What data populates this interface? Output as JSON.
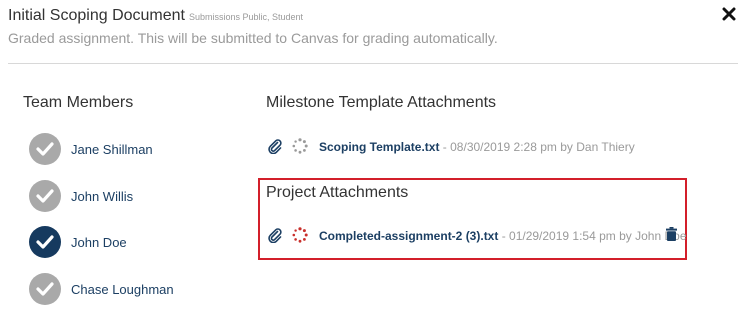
{
  "assignment": {
    "title": "Initial Scoping Document",
    "meta": "Submissions Public, Student",
    "description": "Graded assignment. This will be submitted to Canvas for grading automatically."
  },
  "team": {
    "heading": "Team Members",
    "members": [
      {
        "name": "Jane Shillman",
        "status": "inactive"
      },
      {
        "name": "John Willis",
        "status": "inactive"
      },
      {
        "name": "John Doe",
        "status": "active"
      },
      {
        "name": "Chase Loughman",
        "status": "inactive"
      }
    ]
  },
  "milestone": {
    "heading": "Milestone Template Attachments",
    "file": "Scoping Template.txt",
    "info": " - 08/30/2019 2:28 pm by Dan Thiery"
  },
  "project": {
    "heading": "Project Attachments",
    "file": "Completed-assignment-2 (3).txt",
    "info": " - 01/29/2019 1:54 pm by John Doe"
  },
  "colors": {
    "link": "#1c3f63",
    "active_member": "#163a5f",
    "inactive_member": "#a9a9a9",
    "highlight_border": "#d31f2a",
    "spinner_red": "#c9302c"
  },
  "icons": [
    "close-icon",
    "check-icon",
    "paperclip-icon",
    "loading-spinner-icon",
    "trash-icon"
  ]
}
